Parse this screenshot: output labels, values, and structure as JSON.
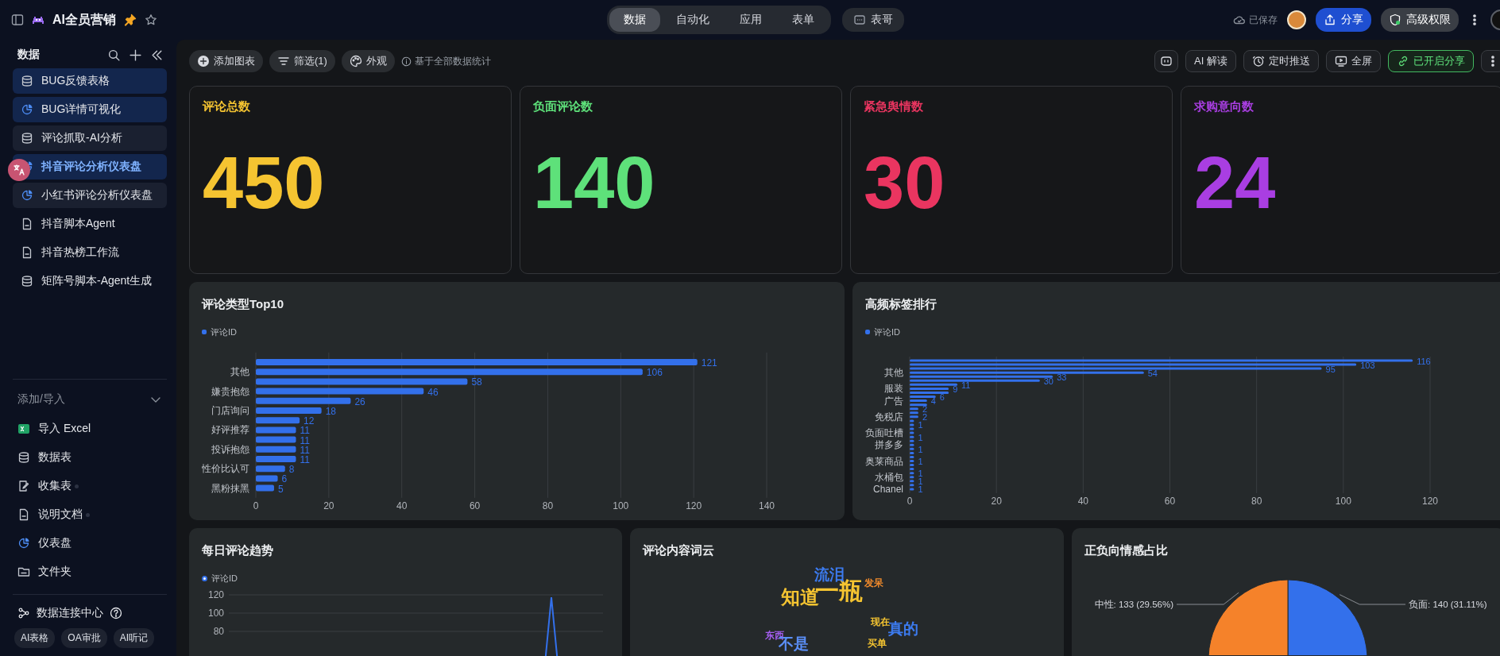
{
  "topbar": {
    "app_title": "AI全员营销",
    "pinned": true,
    "starred": false,
    "tabs": [
      {
        "label": "数据",
        "selected": true
      },
      {
        "label": "自动化",
        "selected": false
      },
      {
        "label": "应用",
        "selected": false
      },
      {
        "label": "表单",
        "selected": false
      }
    ],
    "extra_button": "表哥",
    "save_status": "已保存",
    "share_button": "分享",
    "permission_button": "高级权限"
  },
  "sidebar": {
    "title": "数据",
    "items": [
      {
        "label": "BUG反馈表格",
        "kind": "table",
        "selected": true,
        "current": false,
        "shaded": false
      },
      {
        "label": "BUG详情可视化",
        "kind": "dashboard",
        "selected": true,
        "current": false,
        "shaded": false
      },
      {
        "label": "评论抓取-AI分析",
        "kind": "table",
        "selected": false,
        "current": false,
        "shaded": true
      },
      {
        "label": "抖音评论分析仪表盘",
        "kind": "dashboard",
        "selected": true,
        "current": true,
        "shaded": false
      },
      {
        "label": "小红书评论分析仪表盘",
        "kind": "dashboard",
        "selected": false,
        "current": false,
        "shaded": true
      },
      {
        "label": "抖音脚本Agent",
        "kind": "doc",
        "selected": false,
        "current": false,
        "shaded": false
      },
      {
        "label": "抖音热榜工作流",
        "kind": "doc",
        "selected": false,
        "current": false,
        "shaded": false
      },
      {
        "label": "矩阵号脚本-Agent生成",
        "kind": "table",
        "selected": false,
        "current": false,
        "shaded": false
      }
    ],
    "add_section": {
      "title": "添加/导入",
      "expanded": true,
      "items": [
        {
          "label": "导入 Excel",
          "kind": "excel",
          "dot": false
        },
        {
          "label": "数据表",
          "kind": "table",
          "dot": false
        },
        {
          "label": "收集表",
          "kind": "form",
          "dot": true
        },
        {
          "label": "说明文档",
          "kind": "doc",
          "dot": true
        },
        {
          "label": "仪表盘",
          "kind": "dashboard",
          "dot": false
        },
        {
          "label": "文件夹",
          "kind": "folder",
          "dot": false
        }
      ]
    },
    "connect_label": "数据连接中心",
    "chips": [
      "AI表格",
      "OA审批",
      "AI听记"
    ]
  },
  "toolbar": {
    "left": [
      {
        "label": "添加图表",
        "kind": "add"
      },
      {
        "label": "筛选(1)",
        "kind": "filter"
      },
      {
        "label": "外观",
        "kind": "palette"
      }
    ],
    "note": "基于全部数据统计",
    "right": [
      {
        "kind": "bot"
      },
      {
        "label": "AI 解读",
        "kind": "plain"
      },
      {
        "label": "定时推送",
        "kind": "schedule"
      },
      {
        "label": "全屏",
        "kind": "screen"
      },
      {
        "label": "已开启分享",
        "kind": "link"
      },
      {
        "kind": "more"
      }
    ]
  },
  "kpis": [
    {
      "title": "评论总数",
      "value": "450",
      "color": "#f5c431"
    },
    {
      "title": "负面评论数",
      "value": "140",
      "color": "#5ee17a"
    },
    {
      "title": "紧急舆情数",
      "value": "30",
      "color": "#ea3560"
    },
    {
      "title": "求购意向数",
      "value": "24",
      "color": "#a93ee2"
    }
  ],
  "type_chart": {
    "title": "评论类型Top10",
    "chart_data": {
      "type": "bar",
      "orientation": "horizontal",
      "data_labels": true,
      "categories": [
        null,
        "其他",
        null,
        "嫌贵抱怨",
        null,
        "门店询问",
        null,
        "好评推荐",
        null,
        "投诉抱怨",
        null,
        "性价比认可",
        null,
        "黑粉抹黑"
      ],
      "series": [
        {
          "name": "评论ID",
          "color": "#3370eb",
          "values": [
            121,
            106,
            58,
            46,
            26,
            18,
            12,
            11,
            11,
            11,
            11,
            8,
            6,
            5
          ]
        }
      ],
      "xlim": [
        0,
        140
      ],
      "xticks": [
        0,
        20,
        40,
        60,
        80,
        100,
        120,
        140
      ],
      "grid": true
    }
  },
  "tag_chart": {
    "title": "高频标签排行",
    "chart_data": {
      "type": "bar",
      "orientation": "horizontal",
      "categories": [
        null,
        null,
        null,
        "其他",
        null,
        null,
        null,
        "服装",
        null,
        null,
        "广告",
        null,
        null,
        null,
        "免税店",
        null,
        null,
        null,
        "负面吐槽",
        null,
        null,
        "拼多多",
        null,
        null,
        null,
        "奥莱商品",
        null,
        null,
        null,
        "水桶包",
        null,
        null,
        "Chanel"
      ],
      "series": [
        {
          "name": "评论ID",
          "color": "#3370eb",
          "values": [
            116,
            103,
            95,
            54,
            33,
            30,
            11,
            9,
            9,
            6,
            4,
            4,
            2,
            2,
            2,
            1,
            1,
            1,
            1,
            1,
            1,
            1,
            1,
            1,
            1,
            1,
            1,
            1,
            1,
            1,
            1,
            1,
            1
          ]
        }
      ],
      "value_labels": [
        "116",
        "103",
        "95",
        "54",
        "33",
        "30",
        "11",
        "9",
        null,
        "6",
        "4",
        null,
        "2",
        null,
        "2",
        null,
        "1",
        null,
        null,
        "1",
        null,
        null,
        "1",
        null,
        null,
        "1",
        null,
        null,
        "1",
        null,
        "1",
        null,
        "1"
      ],
      "xlim": [
        0,
        120
      ],
      "xticks": [
        0,
        20,
        40,
        60,
        80,
        100,
        120
      ],
      "grid": true
    }
  },
  "trend": {
    "title": "每日评论趋势",
    "legend": "评论ID",
    "y_axis_labels": [
      "120",
      "100",
      "80"
    ]
  },
  "wordcloud": {
    "title": "评论内容词云",
    "words": [
      {
        "text": "知道",
        "kind": "large",
        "color": "#f5c431"
      },
      {
        "text": "一瓶",
        "kind": "xl",
        "color": "#f5c431"
      },
      {
        "text": "流泪",
        "kind": "medium",
        "color": "#3c7bf0"
      },
      {
        "text": "真的",
        "kind": "medium",
        "color": "#3c7bf0"
      },
      {
        "text": "现在",
        "kind": "small",
        "color": "#f5c431"
      },
      {
        "text": "发呆",
        "kind": "small",
        "color": "#f08a2c"
      },
      {
        "text": "买单",
        "kind": "small",
        "color": "#f5c431"
      },
      {
        "text": "东西",
        "kind": "small",
        "color": "#a55ef0"
      },
      {
        "text": "不是",
        "kind": "medium",
        "color": "#5b8ff9"
      }
    ]
  },
  "sentiment": {
    "title": "正负向情感占比",
    "chart_data": {
      "type": "pie",
      "values": [
        140,
        133
      ],
      "value_labels": [
        "负面: 140 (31.11%)",
        "中性: 133 (29.56%)"
      ]
    }
  }
}
